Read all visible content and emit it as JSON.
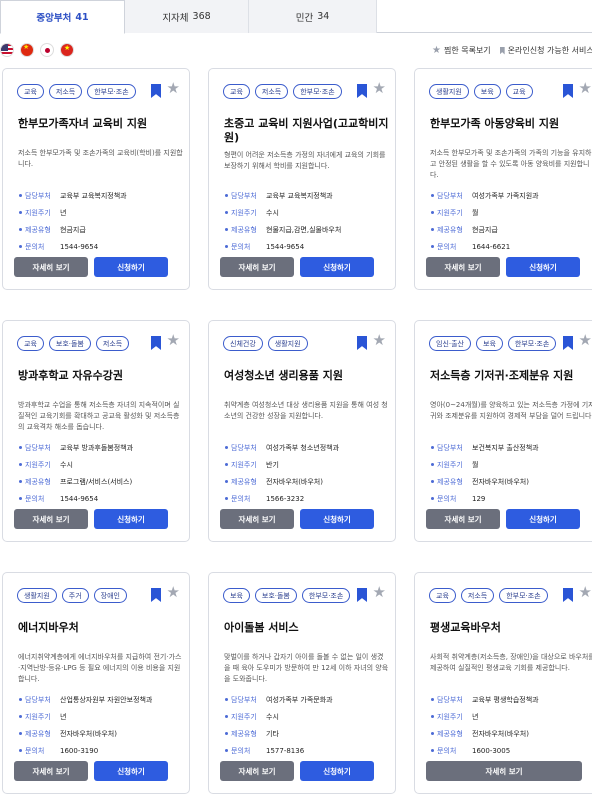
{
  "tabs": [
    {
      "label": "중앙부처",
      "count": "41"
    },
    {
      "label": "지자체",
      "count": "368"
    },
    {
      "label": "민간",
      "count": "34"
    }
  ],
  "legend": {
    "favorites": "찜한 목록보기",
    "online": "온라인신청 가능한 서비스"
  },
  "labels": {
    "dept": "담당부처",
    "cycle": "지원주기",
    "type": "제공유형",
    "contact": "문의처",
    "detail": "자세히 보기",
    "apply": "신청하기"
  },
  "cards": [
    {
      "tags": [
        "교육",
        "저소득",
        "한부모·조손"
      ],
      "title": "한부모가족자녀 교육비 지원",
      "desc": "저소득 한부모가족 및 조손가족의 교육비(학비)를 지원합니다.",
      "dept": "교육부 교육복지정책과",
      "cycle": "년",
      "type": "현금지급",
      "contact": "1544-9654"
    },
    {
      "tags": [
        "교육",
        "저소득",
        "한부모·조손"
      ],
      "title": "초중고 교육비 지원사업(고교학비지원)",
      "desc": "형편이 어려운 저소득층 가정의 자녀에게 교육의 기회를 보장하기 위해서 학비를 지원합니다.",
      "dept": "교육부 교육복지정책과",
      "cycle": "수시",
      "type": "현물지급,감면,실물바우처",
      "contact": "1544-9654"
    },
    {
      "tags": [
        "생활지원",
        "보육",
        "교육"
      ],
      "title": "한부모가족 아동양육비 지원",
      "desc": "저소득 한부모가족 및 조손가족의 가족의 기능을 유지하고 안정된 생활을 할 수 있도록 아동 양육비를 지원합니다.",
      "dept": "여성가족부 가족지원과",
      "cycle": "월",
      "type": "현금지급",
      "contact": "1644-6621"
    },
    {
      "tags": [
        "교육",
        "보호·돌봄",
        "저소득"
      ],
      "title": "방과후학교 자유수강권",
      "desc": "방과후학교 수업을 통해 저소득층 자녀의 지속적이며 실질적인 교육기회를 확대하고 공교육 활성화 및 저소득층의 교육격차 해소를 돕습니다.",
      "dept": "교육부 방과후돌봄정책과",
      "cycle": "수시",
      "type": "프로그램/서비스(서비스)",
      "contact": "1544-9654"
    },
    {
      "tags": [
        "신체건강",
        "생활지원"
      ],
      "title": "여성청소년 생리용품 지원",
      "desc": "취약계층 여성청소년 대상 생리용품 지원을 통해 여성 청소년의 건강한 성장을 지원합니다.",
      "dept": "여성가족부 청소년정책과",
      "cycle": "반기",
      "type": "전자바우처(바우처)",
      "contact": "1566-3232"
    },
    {
      "tags": [
        "임신·출산",
        "보육",
        "한부모·조손"
      ],
      "title": "저소득층 기저귀·조제분유 지원",
      "desc": "영아(0~24개월)를 양육하고 있는 저소득층 가정에 기저귀와 조제분유를 지원하여 경제적 부담을 덜어 드립니다.",
      "dept": "보건복지부 출산정책과",
      "cycle": "월",
      "type": "전자바우처(바우처)",
      "contact": "129"
    },
    {
      "tags": [
        "생활지원",
        "주거",
        "장애인"
      ],
      "title": "에너지바우처",
      "desc": "에너지취약계층에게 에너지바우처를 지급하여 전기·가스·지역난방·등유·LPG 등 필요 에너지의 이용 비용을 지원합니다.",
      "dept": "산업통상자원부 자원안보정책과",
      "cycle": "년",
      "type": "전자바우처(바우처)",
      "contact": "1600-3190"
    },
    {
      "tags": [
        "보육",
        "보호·돌봄",
        "한부모·조손"
      ],
      "title": "아이돌봄 서비스",
      "desc": "맞벌이를 하거나 갑자기 아이를 돌볼 수 없는 일이 생겼을 때 육아 도우미가 방문하여 만 12세 이하 자녀의 양육을 도와줍니다.",
      "dept": "여성가족부 가족문화과",
      "cycle": "수시",
      "type": "기타",
      "contact": "1577-8136"
    },
    {
      "tags": [
        "교육",
        "저소득",
        "한부모·조손"
      ],
      "title": "평생교육바우처",
      "desc": "사회적 취약계층(저소득층, 장애인)을 대상으로 바우처를 제공하여 실질적인 평생교육 기회를 제공합니다.",
      "dept": "교육부 평생학습정책과",
      "cycle": "년",
      "type": "전자바우처(바우처)",
      "contact": "1600-3005"
    }
  ]
}
